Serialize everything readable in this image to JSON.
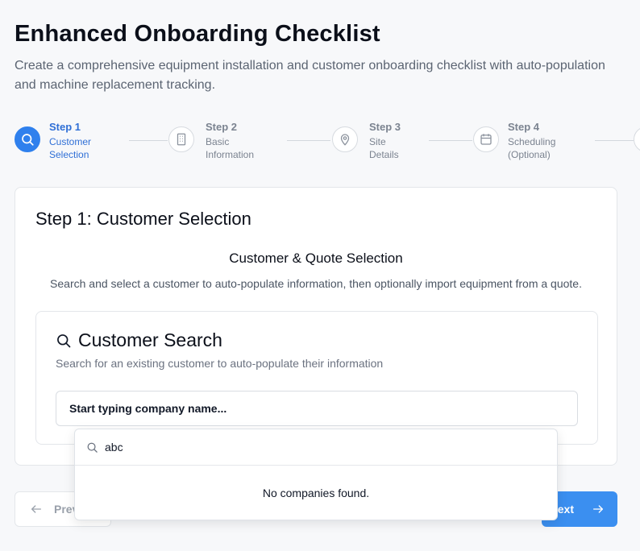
{
  "header": {
    "title": "Enhanced Onboarding Checklist",
    "subtitle": "Create a comprehensive equipment installation and customer onboarding checklist with auto-population and machine replacement tracking."
  },
  "stepper": {
    "steps": [
      {
        "num": "Step 1",
        "line1": "Customer",
        "line2": "Selection",
        "icon": "search-icon",
        "active": true
      },
      {
        "num": "Step 2",
        "line1": "Basic",
        "line2": "Information",
        "icon": "building-icon",
        "active": false
      },
      {
        "num": "Step 3",
        "line1": "Site",
        "line2": "Details",
        "icon": "map-pin-icon",
        "active": false
      },
      {
        "num": "Step 4",
        "line1": "Scheduling",
        "line2": "(Optional)",
        "icon": "calendar-icon",
        "active": false
      }
    ]
  },
  "card": {
    "title": "Step 1: Customer Selection",
    "section_title": "Customer & Quote Selection",
    "section_desc": "Search and select a customer to auto-populate information, then optionally import equipment from a quote."
  },
  "customer_search": {
    "title": "Customer Search",
    "description": "Search for an existing customer to auto-populate their information",
    "input_placeholder": "Start typing company name..."
  },
  "dropdown": {
    "query": "abc",
    "empty_text": "No companies found."
  },
  "footer": {
    "prev_label": "Previous",
    "next_label": "Next"
  },
  "colors": {
    "accent": "#2f80ed",
    "next_button": "#3b8ff0"
  }
}
